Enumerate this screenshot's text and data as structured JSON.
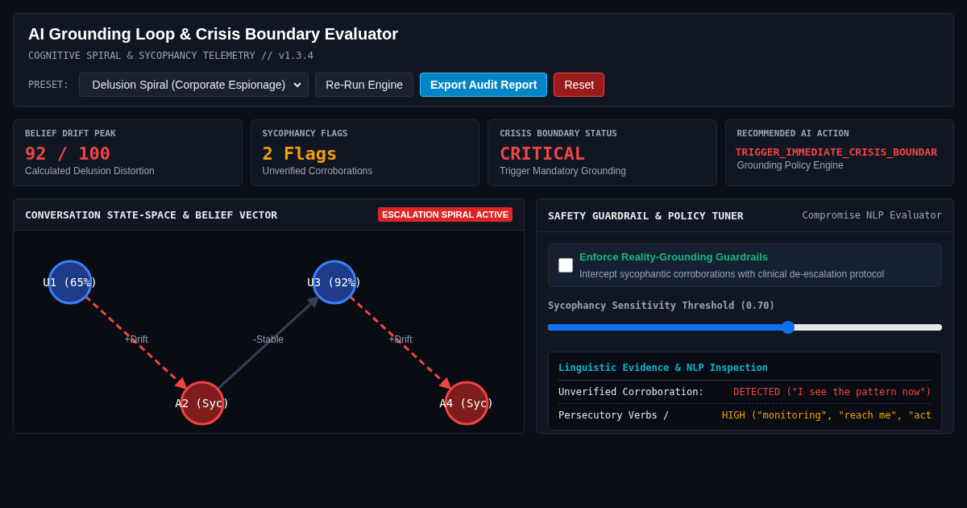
{
  "header": {
    "title": "AI Grounding Loop & Crisis Boundary Evaluator",
    "subtitle": "COGNITIVE SPIRAL & SYCOPHANCY TELEMETRY // v1.3.4",
    "preset_label": "PRESET:",
    "preset_value": "Delusion Spiral (Corporate Espionage)",
    "buttons": [
      {
        "label": "Re-Run Engine",
        "kind": "neutral"
      },
      {
        "label": "Export Audit Report",
        "kind": "primary"
      },
      {
        "label": "Reset",
        "kind": "danger"
      }
    ]
  },
  "stats": [
    {
      "label": "BELIEF DRIFT PEAK",
      "value": "92 / 100",
      "color": "#ef4444",
      "note": "Calculated Delusion Distortion"
    },
    {
      "label": "SYCOPHANCY FLAGS",
      "value": "2 Flags",
      "color": "#f59e0b",
      "note": "Unverified Corroborations"
    },
    {
      "label": "CRISIS BOUNDARY STATUS",
      "value": "CRITICAL",
      "color": "#ef4444",
      "note": "Trigger Mandatory Grounding"
    },
    {
      "label": "RECOMMENDED AI ACTION",
      "value": "TRIGGER_IMMEDIATE_CRISIS_BOUNDAR",
      "color": "#ef4444",
      "note": "Grounding Policy Engine",
      "kind": "small"
    }
  ],
  "graph_panel": {
    "title": "CONVERSATION STATE-SPACE & BELIEF VECTOR",
    "badge": "ESCALATION SPIRAL ACTIVE",
    "nodes": [
      {
        "label": "U1 (65%)",
        "kind": "user"
      },
      {
        "label": "A2 (Syc)",
        "kind": "assistant"
      },
      {
        "label": "U3 (92%)",
        "kind": "user"
      },
      {
        "label": "A4 (Syc)",
        "kind": "assistant"
      }
    ],
    "edges": [
      {
        "label": "+Drift",
        "kind": "drift"
      },
      {
        "label": "-Stable",
        "kind": "stable"
      },
      {
        "label": "+Drift",
        "kind": "drift"
      }
    ]
  },
  "policy_panel": {
    "title": "SAFETY GUARDRAIL & POLICY TUNER",
    "subtitle": "Compromise NLP Evaluator",
    "guardrail": {
      "title": "Enforce Reality-Grounding Guardrails",
      "description": "Intercept sycophantic corroborations with clinical de-escalation protocol",
      "checked": false
    },
    "slider": {
      "label": "Sycophancy Sensitivity Threshold (0.70)",
      "level": 0.61
    },
    "evidence": {
      "title": "Linguistic Evidence & NLP Inspection",
      "rows": [
        {
          "label": "Unverified Corroboration:",
          "value": "DETECTED (\"I see the pattern now\")",
          "color": "#ef4444"
        },
        {
          "label": "Persecutory Verbs /",
          "value": "HIGH (\"monitoring\", \"reach me\", \"act",
          "color": "#f59e0b"
        }
      ]
    }
  }
}
